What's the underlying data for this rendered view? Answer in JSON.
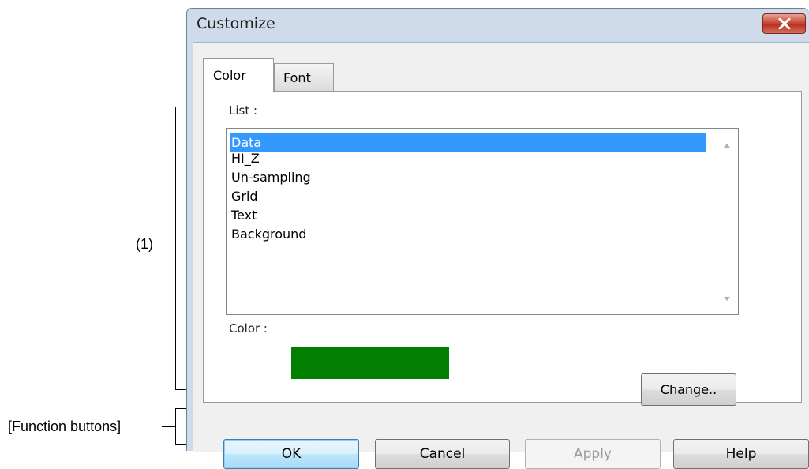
{
  "annotations": {
    "area1": "(1)",
    "function_buttons": "[Function buttons]"
  },
  "dialog": {
    "title": "Customize",
    "close_icon": "close-x-icon",
    "close_color": "#c94a3a"
  },
  "tabs": [
    {
      "label": "Color",
      "active": true
    },
    {
      "label": "Font",
      "active": false
    }
  ],
  "list": {
    "label": "List :",
    "items": [
      "Data",
      "HI_Z",
      "Un-sampling",
      "Grid",
      "Text",
      "Background"
    ],
    "selected_index": 0,
    "selection_color": "#3399ff"
  },
  "color": {
    "label": "Color :",
    "swatch_color": "#007f00",
    "change_label": "Change.."
  },
  "buttons": {
    "ok": "OK",
    "cancel": "Cancel",
    "apply": "Apply",
    "help": "Help"
  }
}
